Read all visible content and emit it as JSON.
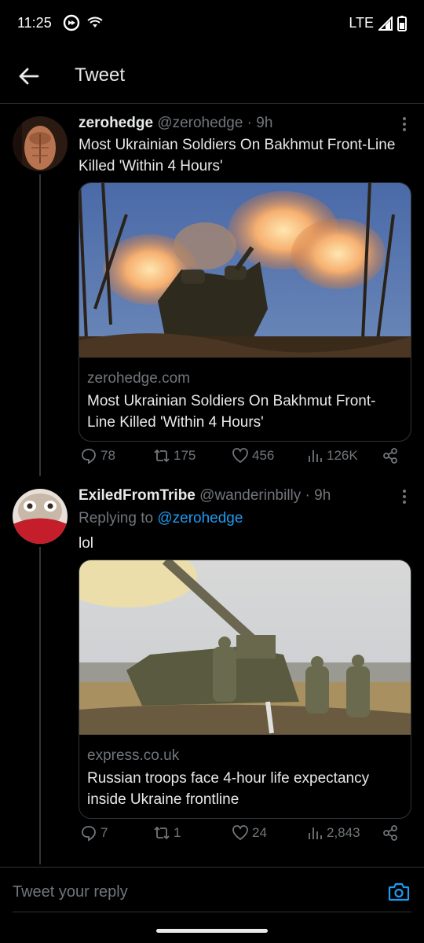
{
  "status": {
    "time": "11:25",
    "network": "LTE"
  },
  "header": {
    "title": "Tweet"
  },
  "tweets": [
    {
      "name": "zerohedge",
      "handle": "@zerohedge · 9h",
      "text": "Most Ukrainian Soldiers On Bakhmut Front-Line Killed 'Within 4 Hours'",
      "card": {
        "domain": "zerohedge.com",
        "title": "Most Ukrainian Soldiers On Bakhmut Front-Line Killed 'Within 4 Hours'"
      },
      "stats": {
        "replies": "78",
        "retweets": "175",
        "likes": "456",
        "views": "126K"
      }
    },
    {
      "name": "ExiledFromTribe",
      "handle": "@wanderinbilly · 9h",
      "reply_prefix": "Replying to",
      "reply_mention": "@zerohedge",
      "text": "lol",
      "card": {
        "domain": "express.co.uk",
        "title": "Russian troops face 4-hour life expectancy inside Ukraine frontline"
      },
      "stats": {
        "replies": "7",
        "retweets": "1",
        "likes": "24",
        "views": "2,843"
      }
    }
  ],
  "reply_box": {
    "placeholder": "Tweet your reply"
  },
  "colors": {
    "background": "#000000",
    "text": "#e7e9ea",
    "muted": "#71767b",
    "accent": "#1d9bf0",
    "border": "#2f3336"
  }
}
